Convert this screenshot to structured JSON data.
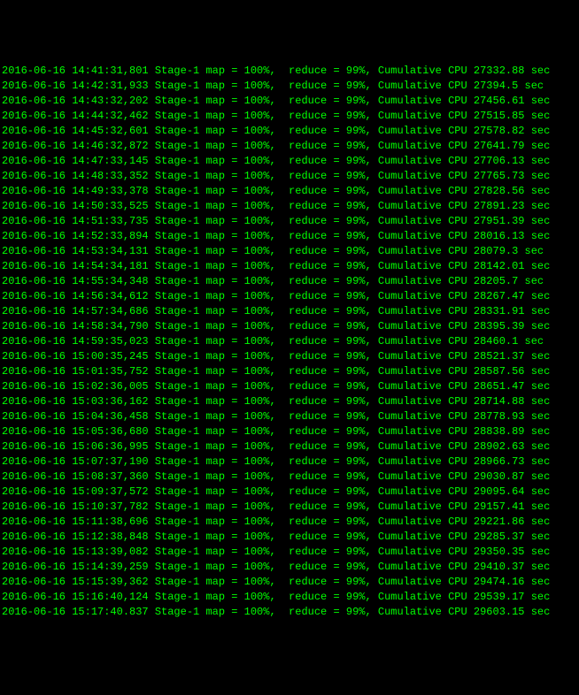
{
  "log_lines": [
    {
      "date": "2016-06-16",
      "time": "14:41:31,801",
      "stage": "Stage-1",
      "map": "100%",
      "reduce": "99%",
      "cpu": "27332.88 sec"
    },
    {
      "date": "2016-06-16",
      "time": "14:42:31,933",
      "stage": "Stage-1",
      "map": "100%",
      "reduce": "99%",
      "cpu": "27394.5 sec"
    },
    {
      "date": "2016-06-16",
      "time": "14:43:32,202",
      "stage": "Stage-1",
      "map": "100%",
      "reduce": "99%",
      "cpu": "27456.61 sec"
    },
    {
      "date": "2016-06-16",
      "time": "14:44:32,462",
      "stage": "Stage-1",
      "map": "100%",
      "reduce": "99%",
      "cpu": "27515.85 sec"
    },
    {
      "date": "2016-06-16",
      "time": "14:45:32,601",
      "stage": "Stage-1",
      "map": "100%",
      "reduce": "99%",
      "cpu": "27578.82 sec"
    },
    {
      "date": "2016-06-16",
      "time": "14:46:32,872",
      "stage": "Stage-1",
      "map": "100%",
      "reduce": "99%",
      "cpu": "27641.79 sec"
    },
    {
      "date": "2016-06-16",
      "time": "14:47:33,145",
      "stage": "Stage-1",
      "map": "100%",
      "reduce": "99%",
      "cpu": "27706.13 sec"
    },
    {
      "date": "2016-06-16",
      "time": "14:48:33,352",
      "stage": "Stage-1",
      "map": "100%",
      "reduce": "99%",
      "cpu": "27765.73 sec"
    },
    {
      "date": "2016-06-16",
      "time": "14:49:33,378",
      "stage": "Stage-1",
      "map": "100%",
      "reduce": "99%",
      "cpu": "27828.56 sec"
    },
    {
      "date": "2016-06-16",
      "time": "14:50:33,525",
      "stage": "Stage-1",
      "map": "100%",
      "reduce": "99%",
      "cpu": "27891.23 sec"
    },
    {
      "date": "2016-06-16",
      "time": "14:51:33,735",
      "stage": "Stage-1",
      "map": "100%",
      "reduce": "99%",
      "cpu": "27951.39 sec"
    },
    {
      "date": "2016-06-16",
      "time": "14:52:33,894",
      "stage": "Stage-1",
      "map": "100%",
      "reduce": "99%",
      "cpu": "28016.13 sec"
    },
    {
      "date": "2016-06-16",
      "time": "14:53:34,131",
      "stage": "Stage-1",
      "map": "100%",
      "reduce": "99%",
      "cpu": "28079.3 sec"
    },
    {
      "date": "2016-06-16",
      "time": "14:54:34,181",
      "stage": "Stage-1",
      "map": "100%",
      "reduce": "99%",
      "cpu": "28142.01 sec"
    },
    {
      "date": "2016-06-16",
      "time": "14:55:34,348",
      "stage": "Stage-1",
      "map": "100%",
      "reduce": "99%",
      "cpu": "28205.7 sec"
    },
    {
      "date": "2016-06-16",
      "time": "14:56:34,612",
      "stage": "Stage-1",
      "map": "100%",
      "reduce": "99%",
      "cpu": "28267.47 sec"
    },
    {
      "date": "2016-06-16",
      "time": "14:57:34,686",
      "stage": "Stage-1",
      "map": "100%",
      "reduce": "99%",
      "cpu": "28331.91 sec"
    },
    {
      "date": "2016-06-16",
      "time": "14:58:34,790",
      "stage": "Stage-1",
      "map": "100%",
      "reduce": "99%",
      "cpu": "28395.39 sec"
    },
    {
      "date": "2016-06-16",
      "time": "14:59:35,023",
      "stage": "Stage-1",
      "map": "100%",
      "reduce": "99%",
      "cpu": "28460.1 sec"
    },
    {
      "date": "2016-06-16",
      "time": "15:00:35,245",
      "stage": "Stage-1",
      "map": "100%",
      "reduce": "99%",
      "cpu": "28521.37 sec"
    },
    {
      "date": "2016-06-16",
      "time": "15:01:35,752",
      "stage": "Stage-1",
      "map": "100%",
      "reduce": "99%",
      "cpu": "28587.56 sec"
    },
    {
      "date": "2016-06-16",
      "time": "15:02:36,005",
      "stage": "Stage-1",
      "map": "100%",
      "reduce": "99%",
      "cpu": "28651.47 sec"
    },
    {
      "date": "2016-06-16",
      "time": "15:03:36,162",
      "stage": "Stage-1",
      "map": "100%",
      "reduce": "99%",
      "cpu": "28714.88 sec"
    },
    {
      "date": "2016-06-16",
      "time": "15:04:36,458",
      "stage": "Stage-1",
      "map": "100%",
      "reduce": "99%",
      "cpu": "28778.93 sec"
    },
    {
      "date": "2016-06-16",
      "time": "15:05:36,680",
      "stage": "Stage-1",
      "map": "100%",
      "reduce": "99%",
      "cpu": "28838.89 sec"
    },
    {
      "date": "2016-06-16",
      "time": "15:06:36,995",
      "stage": "Stage-1",
      "map": "100%",
      "reduce": "99%",
      "cpu": "28902.63 sec"
    },
    {
      "date": "2016-06-16",
      "time": "15:07:37,190",
      "stage": "Stage-1",
      "map": "100%",
      "reduce": "99%",
      "cpu": "28966.73 sec"
    },
    {
      "date": "2016-06-16",
      "time": "15:08:37,360",
      "stage": "Stage-1",
      "map": "100%",
      "reduce": "99%",
      "cpu": "29030.87 sec"
    },
    {
      "date": "2016-06-16",
      "time": "15:09:37,572",
      "stage": "Stage-1",
      "map": "100%",
      "reduce": "99%",
      "cpu": "29095.64 sec"
    },
    {
      "date": "2016-06-16",
      "time": "15:10:37,782",
      "stage": "Stage-1",
      "map": "100%",
      "reduce": "99%",
      "cpu": "29157.41 sec"
    },
    {
      "date": "2016-06-16",
      "time": "15:11:38,696",
      "stage": "Stage-1",
      "map": "100%",
      "reduce": "99%",
      "cpu": "29221.86 sec"
    },
    {
      "date": "2016-06-16",
      "time": "15:12:38,848",
      "stage": "Stage-1",
      "map": "100%",
      "reduce": "99%",
      "cpu": "29285.37 sec"
    },
    {
      "date": "2016-06-16",
      "time": "15:13:39,082",
      "stage": "Stage-1",
      "map": "100%",
      "reduce": "99%",
      "cpu": "29350.35 sec"
    },
    {
      "date": "2016-06-16",
      "time": "15:14:39,259",
      "stage": "Stage-1",
      "map": "100%",
      "reduce": "99%",
      "cpu": "29410.37 sec"
    },
    {
      "date": "2016-06-16",
      "time": "15:15:39,362",
      "stage": "Stage-1",
      "map": "100%",
      "reduce": "99%",
      "cpu": "29474.16 sec"
    },
    {
      "date": "2016-06-16",
      "time": "15:16:40,124",
      "stage": "Stage-1",
      "map": "100%",
      "reduce": "99%",
      "cpu": "29539.17 sec"
    },
    {
      "date": "2016-06-16",
      "time": "15:17:40.837",
      "stage": "Stage-1",
      "map": "100%",
      "reduce": "99%",
      "cpu": "29603.15 sec"
    }
  ]
}
